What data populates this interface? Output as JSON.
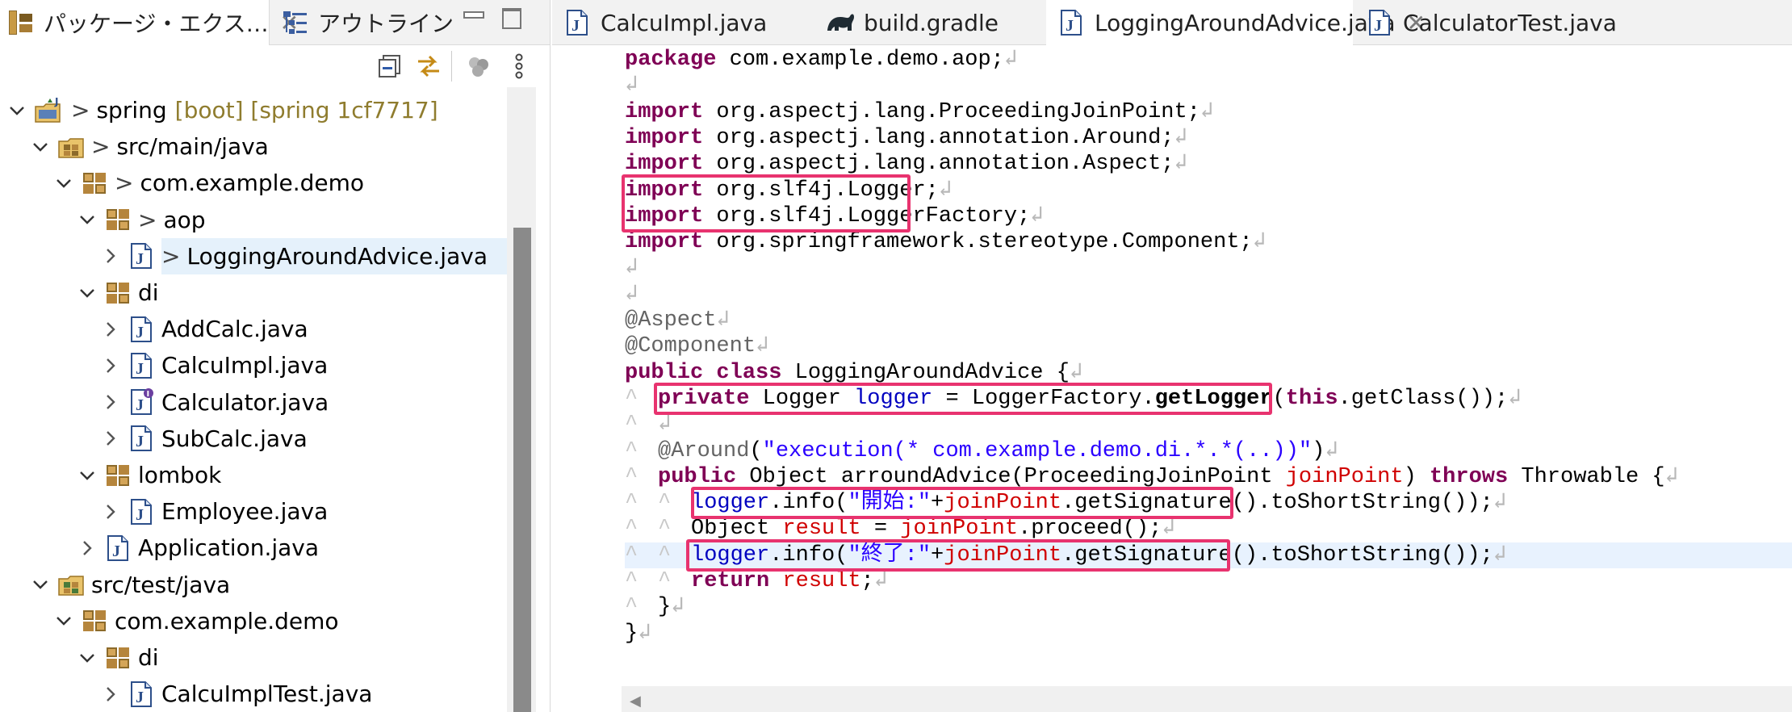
{
  "left_view": {
    "tabs": [
      {
        "label": "パッケージ・エクス…",
        "icon": "package-explorer-icon",
        "closable": true,
        "active": true
      },
      {
        "label": "アウトライン",
        "icon": "outline-icon",
        "closable": false,
        "active": false
      }
    ],
    "toolbar": [
      "collapse-all-icon",
      "link-with-editor-icon",
      "filter-icon",
      "view-menu-icon"
    ],
    "tree": [
      {
        "label": "spring",
        "decor": "[boot] [spring 1cf7717]",
        "dirty": ">",
        "icon": "project-icon",
        "level": 0,
        "expanded": true
      },
      {
        "label": "src/main/java",
        "dirty": ">",
        "icon": "source-folder-icon",
        "level": 1,
        "expanded": true
      },
      {
        "label": "com.example.demo",
        "dirty": ">",
        "icon": "package-icon",
        "level": 2,
        "expanded": true
      },
      {
        "label": "aop",
        "dirty": ">",
        "icon": "package-icon",
        "level": 3,
        "expanded": true
      },
      {
        "label": "LoggingAroundAdvice.java",
        "dirty": ">",
        "icon": "java-file-icon",
        "level": 4,
        "expanded": false,
        "selected": true
      },
      {
        "label": "di",
        "icon": "package-icon",
        "level": 3,
        "expanded": true
      },
      {
        "label": "AddCalc.java",
        "icon": "java-file-icon",
        "level": 4,
        "expanded": false
      },
      {
        "label": "CalcuImpl.java",
        "icon": "java-file-icon",
        "level": 4,
        "expanded": false
      },
      {
        "label": "Calculator.java",
        "icon": "java-interface-file-icon",
        "level": 4,
        "expanded": false
      },
      {
        "label": "SubCalc.java",
        "icon": "java-file-icon",
        "level": 4,
        "expanded": false
      },
      {
        "label": "lombok",
        "icon": "package-icon",
        "level": 3,
        "expanded": true
      },
      {
        "label": "Employee.java",
        "icon": "java-file-icon",
        "level": 4,
        "expanded": false
      },
      {
        "label": "Application.java",
        "icon": "java-file-icon",
        "level": 3,
        "expanded": false
      },
      {
        "label": "src/test/java",
        "icon": "source-folder-icon",
        "level": 1,
        "expanded": true
      },
      {
        "label": "com.example.demo",
        "icon": "package-icon",
        "level": 2,
        "expanded": true
      },
      {
        "label": "di",
        "icon": "package-icon",
        "level": 3,
        "expanded": true
      },
      {
        "label": "CalcuImplTest.java",
        "icon": "java-file-icon",
        "level": 4,
        "expanded": false
      }
    ]
  },
  "editor": {
    "tabs": [
      {
        "label": "CalcuImpl.java",
        "icon": "java-file-icon",
        "active": false,
        "closable": false
      },
      {
        "label": "build.gradle",
        "icon": "gradle-icon",
        "active": false,
        "closable": false
      },
      {
        "label": "LoggingAroundAdvice.java",
        "icon": "java-file-icon",
        "active": true,
        "closable": true
      },
      {
        "label": "CalculatorTest.java",
        "icon": "java-file-icon",
        "active": false,
        "closable": false
      }
    ],
    "current_line": 20,
    "changed_lines": [
      18,
      20
    ],
    "highlighted_line_numbers": [
      6,
      7,
      10,
      14,
      15,
      18,
      20
    ],
    "lines": [
      {
        "n": "1",
        "indent": 0,
        "tokens": [
          [
            "kw",
            "package"
          ],
          [
            "t",
            " com.example.demo.aop;"
          ]
        ]
      },
      {
        "n": "2",
        "indent": 0,
        "tokens": []
      },
      {
        "n": "3",
        "indent": 0,
        "fold": true,
        "tokens": [
          [
            "kw",
            "import"
          ],
          [
            "t",
            " org.aspectj.lang.ProceedingJoinPoint;"
          ]
        ]
      },
      {
        "n": "4",
        "indent": 0,
        "tokens": [
          [
            "kw",
            "import"
          ],
          [
            "t",
            " org.aspectj.lang.annotation.Around;"
          ]
        ]
      },
      {
        "n": "5",
        "indent": 0,
        "tokens": [
          [
            "kw",
            "import"
          ],
          [
            "t",
            " org.aspectj.lang.annotation.Aspect;"
          ]
        ]
      },
      {
        "n": "6",
        "indent": 0,
        "tokens": [
          [
            "kw",
            "import"
          ],
          [
            "t",
            " org.slf4j.Logger;"
          ]
        ]
      },
      {
        "n": "7",
        "indent": 0,
        "tokens": [
          [
            "kw",
            "import"
          ],
          [
            "t",
            " org.slf4j.LoggerFactory;"
          ]
        ]
      },
      {
        "n": "8",
        "indent": 0,
        "tokens": [
          [
            "kw",
            "import"
          ],
          [
            "t",
            " org.springframework.stereotype.Component;"
          ]
        ]
      },
      {
        "n": "9",
        "indent": 0,
        "tokens": []
      },
      {
        "n": "10",
        "indent": 0,
        "tokens": []
      },
      {
        "n": "11",
        "indent": 0,
        "tokens": [
          [
            "anno",
            "@Aspect"
          ]
        ]
      },
      {
        "n": "12",
        "indent": 0,
        "tokens": [
          [
            "anno",
            "@Component"
          ]
        ]
      },
      {
        "n": "13",
        "indent": 0,
        "tokens": [
          [
            "kw",
            "public"
          ],
          [
            "t",
            " "
          ],
          [
            "kw",
            "class"
          ],
          [
            "t",
            " LoggingAroundAdvice {"
          ]
        ]
      },
      {
        "n": "14",
        "indent": 1,
        "tokens": [
          [
            "kw",
            "private"
          ],
          [
            "t",
            " Logger "
          ],
          [
            "fld",
            "logger"
          ],
          [
            "t",
            " = LoggerFactory."
          ],
          [
            "bold",
            "getLogger"
          ],
          [
            "t",
            "("
          ],
          [
            "kw",
            "this"
          ],
          [
            "t",
            ".getClass());"
          ]
        ]
      },
      {
        "n": "15",
        "indent": 1,
        "tokens": []
      },
      {
        "n": "16",
        "indent": 1,
        "fold": true,
        "tokens": [
          [
            "anno",
            "@Around"
          ],
          [
            "t",
            "("
          ],
          [
            "str",
            "\"execution(* com.example.demo.di.*.*(..))\""
          ],
          [
            "t",
            ")"
          ]
        ]
      },
      {
        "n": "17",
        "indent": 1,
        "tokens": [
          [
            "kw",
            "public"
          ],
          [
            "t",
            " Object arroundAdvice(ProceedingJoinPoint "
          ],
          [
            "loc",
            "joinPoint"
          ],
          [
            "t",
            ") "
          ],
          [
            "kw",
            "throws"
          ],
          [
            "t",
            " Throwable {"
          ]
        ]
      },
      {
        "n": "18",
        "indent": 2,
        "tokens": [
          [
            "fld",
            "logger"
          ],
          [
            "t",
            ".info("
          ],
          [
            "str",
            "\"開始:\""
          ],
          [
            "t",
            "+"
          ],
          [
            "loc",
            "joinPoint"
          ],
          [
            "t",
            ".getSignature().toShortString());"
          ]
        ]
      },
      {
        "n": "19",
        "indent": 2,
        "tokens": [
          [
            "t",
            "Object "
          ],
          [
            "loc",
            "result"
          ],
          [
            "t",
            " = "
          ],
          [
            "loc",
            "joinPoint"
          ],
          [
            "t",
            ".proceed();"
          ]
        ]
      },
      {
        "n": "20",
        "indent": 2,
        "tokens": [
          [
            "fld",
            "logger"
          ],
          [
            "t",
            ".info("
          ],
          [
            "str",
            "\"終了:\""
          ],
          [
            "t",
            "+"
          ],
          [
            "loc",
            "joinPoint"
          ],
          [
            "t",
            ".getSignature().toShortString());"
          ]
        ]
      },
      {
        "n": "21",
        "indent": 2,
        "tokens": [
          [
            "kw",
            "return"
          ],
          [
            "t",
            " "
          ],
          [
            "loc",
            "result"
          ],
          [
            "t",
            ";"
          ]
        ]
      },
      {
        "n": "22",
        "indent": 1,
        "tokens": [
          [
            "t",
            "}"
          ]
        ]
      },
      {
        "n": "23",
        "indent": 0,
        "tokens": [
          [
            "t",
            "}"
          ]
        ]
      },
      {
        "n": "24",
        "indent": 0,
        "eof": true,
        "tokens": []
      }
    ],
    "annotation_boxes": [
      {
        "label": "slf4j-imports",
        "from_line": 6,
        "to_line": 7
      },
      {
        "label": "logger-field",
        "from_line": 14,
        "to_line": 14
      },
      {
        "label": "start-log",
        "from_line": 18,
        "to_line": 18
      },
      {
        "label": "end-log",
        "from_line": 20,
        "to_line": 20
      }
    ]
  },
  "colors": {
    "keyword": "#7f0055",
    "string": "#2a00ff",
    "field": "#0000c0",
    "local_variable": "#d00000",
    "annotation": "#646464",
    "highlight_box": "#e8336f",
    "current_line": "#e8f2fe",
    "tree_decoration": "#8f7c2e"
  }
}
